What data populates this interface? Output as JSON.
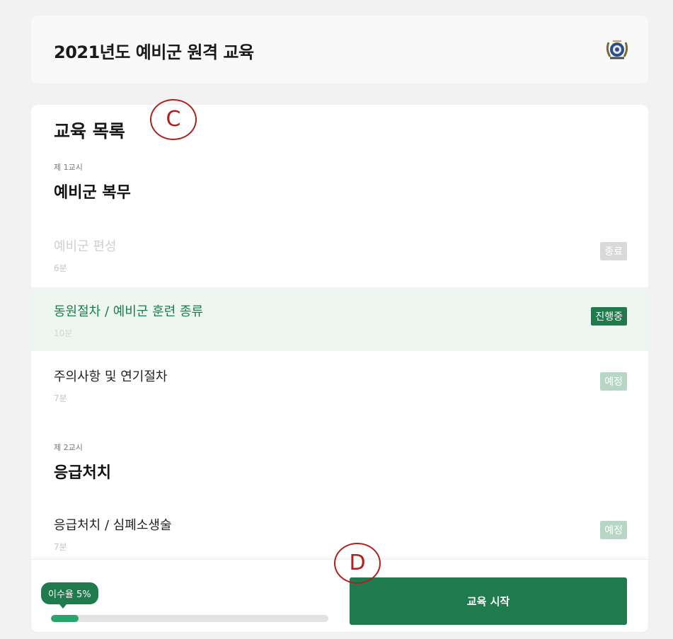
{
  "header": {
    "title": "2021년도 예비군 원격 교육",
    "emblem_icon": "reserve-forces-emblem-icon"
  },
  "list": {
    "title": "교육 목록",
    "periods": [
      {
        "label": "제 1교시",
        "name": "예비군 복무",
        "lessons": [
          {
            "name": "예비군 편성",
            "duration": "6분",
            "status": "종료"
          },
          {
            "name": "동원절차 / 예비군 훈련 종류",
            "duration": "10분",
            "status": "진행중"
          },
          {
            "name": "주의사항 및 연기절차",
            "duration": "7분",
            "status": "예정"
          }
        ]
      },
      {
        "label": "제 2교시",
        "name": "응급처치",
        "lessons": [
          {
            "name": "응급처치 / 심폐소생술",
            "duration": "7분",
            "status": "예정"
          }
        ]
      }
    ]
  },
  "annotations": {
    "c": "C",
    "d": "D"
  },
  "footer": {
    "progress_label": "이수율 5%",
    "progress_value": 0.05,
    "start_button": "교육 시작"
  },
  "colors": {
    "accent": "#1f7a4d",
    "active_bg": "#eef6f2",
    "scheduled": "#b7d6c6",
    "done": "#d9d9d9"
  }
}
